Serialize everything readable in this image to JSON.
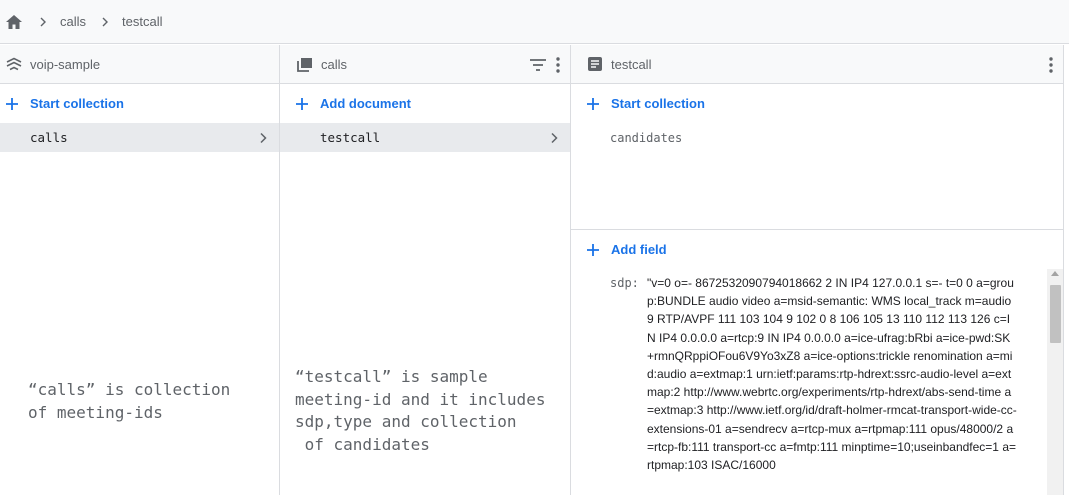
{
  "breadcrumb": {
    "items": [
      "calls",
      "testcall"
    ]
  },
  "colors": {
    "accent": "#1a73e8",
    "header_bg": "#f8f9fa",
    "selected_bg": "#e8eaed",
    "border": "#dadce0"
  },
  "panels": [
    {
      "title": "voip-sample",
      "icon": "database-icon",
      "action": "Start collection",
      "items": [
        {
          "label": "calls",
          "selected": true
        }
      ],
      "annotation": "“calls” is collection\nof meeting-ids"
    },
    {
      "title": "calls",
      "icon": "collection-icon",
      "action": "Add document",
      "items": [
        {
          "label": "testcall",
          "selected": true
        }
      ],
      "annotation": "“testcall” is sample\nmeeting-id and it includes\nsdp,type and collection\n of candidates"
    },
    {
      "title": "testcall",
      "icon": "document-icon",
      "action": "Start collection",
      "subcollections": [
        "candidates"
      ],
      "field_action": "Add field",
      "fields": [
        {
          "key": "sdp:",
          "value": "\"v=0 o=- 8672532090794018662 2 IN IP4 127.0.0.1 s=- t=0 0 a=group:BUNDLE audio video a=msid-semantic: WMS local_track m=audio 9 RTP/AVPF 111 103 104 9 102 0 8 106 105 13 110 112 113 126 c=IN IP4 0.0.0.0 a=rtcp:9 IN IP4 0.0.0.0 a=ice-ufrag:bRbi a=ice-pwd:SK+rmnQRppiOFou6V9Yo3xZ8 a=ice-options:trickle renomination a=mid:audio a=extmap:1 urn:ietf:params:rtp-hdrext:ssrc-audio-level a=extmap:2 http://www.webrtc.org/experiments/rtp-hdrext/abs-send-time a=extmap:3 http://www.ietf.org/id/draft-holmer-rmcat-transport-wide-cc-extensions-01 a=sendrecv a=rtcp-mux a=rtpmap:111 opus/48000/2 a=rtcp-fb:111 transport-cc a=fmtp:111 minptime=10;useinbandfec=1 a=rtpmap:103 ISAC/16000"
        }
      ]
    }
  ]
}
